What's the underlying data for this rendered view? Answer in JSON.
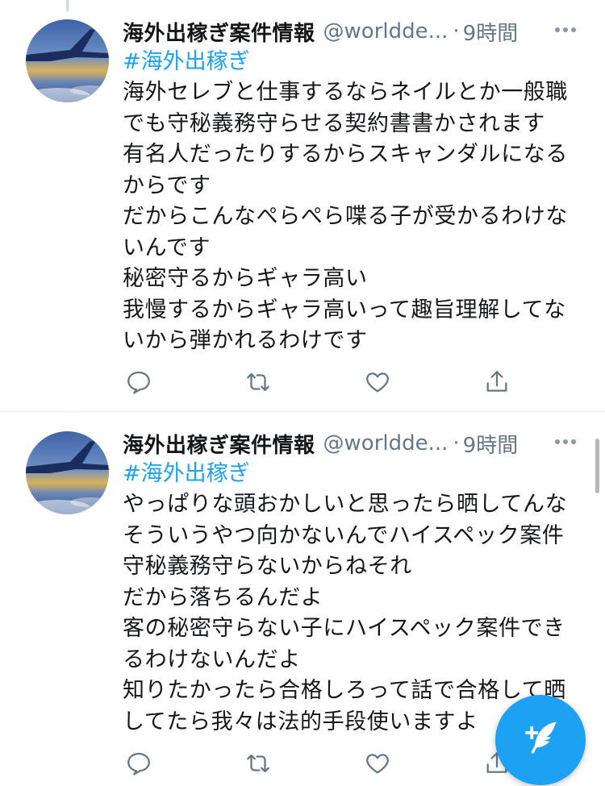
{
  "colors": {
    "accent": "#1da1f2",
    "text": "#14171a",
    "secondary": "#657786",
    "icon": "#657786"
  },
  "tweets": [
    {
      "display_name": "海外出稼ぎ案件情報",
      "handle": "@worldde...",
      "separator": "·",
      "time": "9時間",
      "hashtag": "#海外出稼ぎ",
      "lines": [
        "海外セレブと仕事するならネイルとか一般職",
        "でも守秘義務守らせる契約書書かされます",
        "有名人だったりするからスキャンダルになる",
        "からです",
        "だからこんなぺらぺら喋る子が受かるわけな",
        "いんです",
        "秘密守るからギャラ高い",
        "我慢するからギャラ高いって趣旨理解してな",
        "いから弾かれるわけです"
      ],
      "icons": [
        "reply-icon",
        "retweet-icon",
        "like-icon",
        "share-icon"
      ]
    },
    {
      "display_name": "海外出稼ぎ案件情報",
      "handle": "@worldde...",
      "separator": "·",
      "time": "9時間",
      "hashtag": "#海外出稼ぎ",
      "lines": [
        "やっぱりな頭おかしいと思ったら晒してんな",
        "そういうやつ向かないんでハイスペック案件",
        "守秘義務守らないからねそれ",
        "だから落ちるんだよ",
        "客の秘密守らない子にハイスペック案件でき",
        "るわけないんだよ",
        "知りたかったら合格しろって話で合格して晒",
        "してたら我々は法的手段使いますよ"
      ],
      "icons": [
        "reply-icon",
        "retweet-icon",
        "like-icon",
        "share-icon"
      ]
    }
  ],
  "compose_button": {
    "icon": "compose-tweet-icon"
  }
}
